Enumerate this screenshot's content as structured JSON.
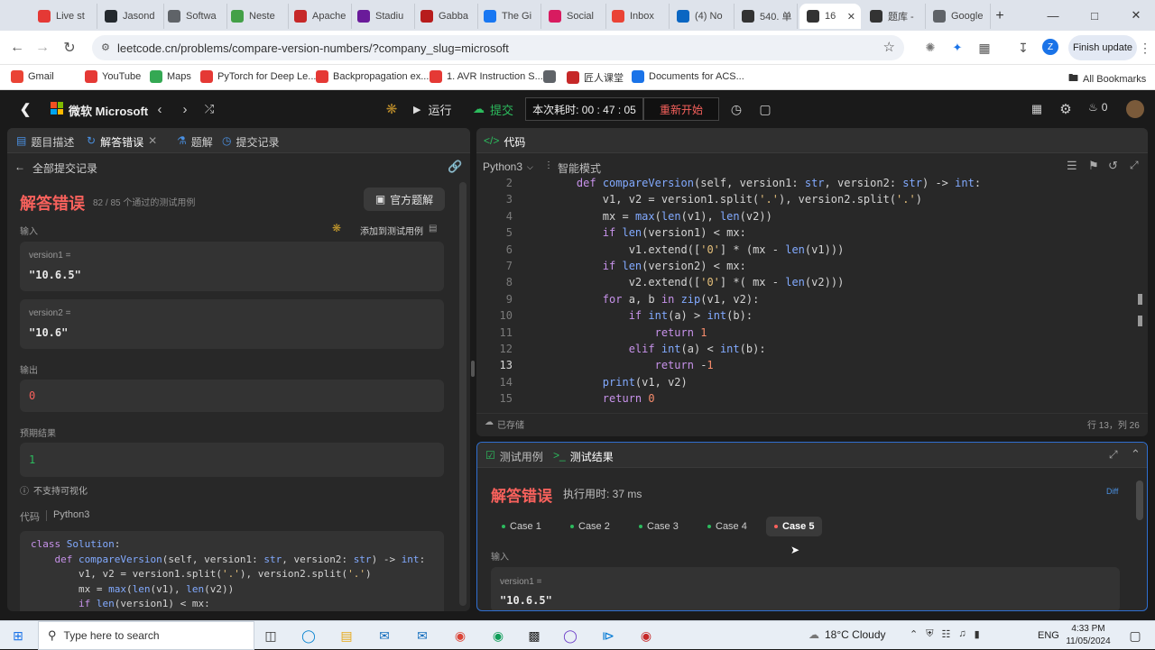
{
  "browser": {
    "tabs": [
      {
        "label": "Live st",
        "color": "#e53935"
      },
      {
        "label": "Jasond",
        "color": "#24292e"
      },
      {
        "label": "Softwa",
        "color": "#5f6368"
      },
      {
        "label": "Neste",
        "color": "#43a047"
      },
      {
        "label": "Apache",
        "color": "#c62828"
      },
      {
        "label": "Stadiu",
        "color": "#6a1b9a"
      },
      {
        "label": "Gabba",
        "color": "#b71c1c"
      },
      {
        "label": "The Gi",
        "color": "#1877f2"
      },
      {
        "label": "Social",
        "color": "#d81b60"
      },
      {
        "label": "Inbox",
        "color": "#ea4335"
      },
      {
        "label": "(4) No",
        "color": "#0a66c2"
      },
      {
        "label": "540. 单",
        "color": "#333333"
      },
      {
        "label": "16",
        "color": "#333333"
      },
      {
        "label": "题库 -",
        "color": "#333333"
      },
      {
        "label": "Google",
        "color": "#5f6368"
      }
    ],
    "url": "leetcode.cn/problems/compare-version-numbers/?company_slug=microsoft",
    "finish_update": "Finish update",
    "profile_initial": "Z",
    "bookmarks": [
      "Gmail",
      "YouTube",
      "Maps",
      "PyTorch for Deep Le...",
      "Backpropagation ex...",
      "1. AVR Instruction S...",
      "",
      "匠人课堂",
      "Documents for ACS..."
    ],
    "all_bookmarks": "All Bookmarks"
  },
  "lc_header": {
    "company": "微软 Microsoft",
    "run": "运行",
    "submit": "提交",
    "timer": "本次耗时: 00 : 47 : 05",
    "restart": "重新开始",
    "streak": "0"
  },
  "left": {
    "tabs": [
      "题目描述",
      "解答错误",
      "题解",
      "提交记录"
    ],
    "back_label": "全部提交记录",
    "result_title": "解答错误",
    "passed": "82 / 85  个通过的测试用例",
    "official_solution": "官方题解",
    "input_label": "输入",
    "add_case": "添加到测试用例",
    "v1_label": "version1 =",
    "v1_value": "\"10.6.5\"",
    "v2_label": "version2 =",
    "v2_value": "\"10.6\"",
    "output_label": "输出",
    "output_value": "0",
    "expected_label": "预期结果",
    "expected_value": "1",
    "no_visual": "不支持可视化",
    "code_label": "代码",
    "code_lang": "Python3",
    "code_lines": [
      "class Solution:",
      "    def compareVersion(self, version1: str, version2: str) -> int:",
      "        v1, v2 = version1.split('.'), version2.split('.')",
      "        mx = max(len(v1), len(v2))",
      "        if len(version1) < mx:"
    ]
  },
  "editor": {
    "title": "代码",
    "lang": "Python3",
    "mode": "智能模式",
    "saved": "已存储",
    "cursor": "行 13，列 26",
    "current_line": 13,
    "lines": [
      {
        "n": "2",
        "t": "    def compareVersion(self, version1: str, version2: str) -> int:"
      },
      {
        "n": "3",
        "t": "        v1, v2 = version1.split('.'), version2.split('.')"
      },
      {
        "n": "4",
        "t": "        mx = max(len(v1), len(v2))"
      },
      {
        "n": "5",
        "t": "        if len(version1) < mx:"
      },
      {
        "n": "6",
        "t": "            v1.extend(['0'] * (mx - len(v1)))"
      },
      {
        "n": "7",
        "t": "        if len(version2) < mx:"
      },
      {
        "n": "8",
        "t": "            v2.extend(['0'] *( mx - len(v2)))"
      },
      {
        "n": "9",
        "t": "        for a, b in zip(v1, v2):"
      },
      {
        "n": "10",
        "t": "            if int(a) > int(b):"
      },
      {
        "n": "11",
        "t": "                return 1"
      },
      {
        "n": "12",
        "t": "            elif int(a) < int(b):"
      },
      {
        "n": "13",
        "t": "                return -1"
      },
      {
        "n": "14",
        "t": "        print(v1, v2)"
      },
      {
        "n": "15",
        "t": "        return 0"
      }
    ]
  },
  "results": {
    "tab_cases": "测试用例",
    "tab_result": "测试结果",
    "status": "解答错误",
    "runtime": "执行用时: 37 ms",
    "diff": "Diff",
    "cases": [
      "Case 1",
      "Case 2",
      "Case 3",
      "Case 4",
      "Case 5"
    ],
    "active_case": 4,
    "input_label": "输入",
    "v1_label": "version1 =",
    "v1_value": "\"10.6.5\""
  },
  "taskbar": {
    "search_placeholder": "Type here to search",
    "weather": "18°C  Cloudy",
    "lang": "ENG",
    "time": "4:33 PM",
    "date": "11/05/2024"
  },
  "colors": {
    "accent_red": "#f8615c",
    "accent_green": "#2cbb5d",
    "accent_blue": "#2f6fd0"
  }
}
